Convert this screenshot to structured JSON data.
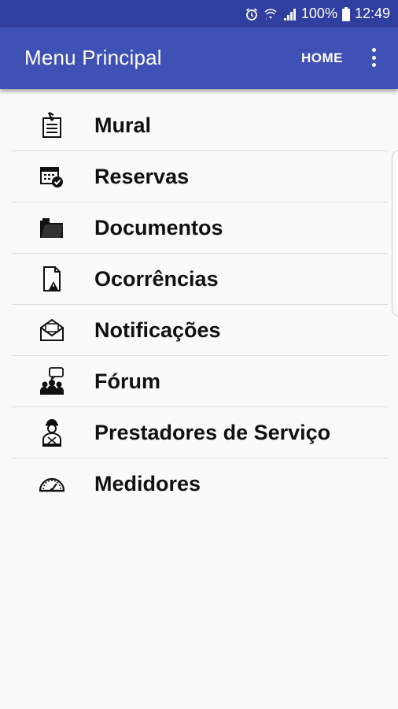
{
  "status_bar": {
    "battery": "100%",
    "time": "12:49",
    "icons": [
      "alarm-icon",
      "wifi-icon",
      "signal-icon",
      "battery-icon"
    ]
  },
  "app_bar": {
    "title": "Menu Principal",
    "home_label": "HOME",
    "overflow_icon": "more-vert-icon",
    "color": "#3f51b5",
    "status_color": "#303f9f"
  },
  "menu": {
    "items": [
      {
        "label": "Mural",
        "icon": "bulletin-board-icon"
      },
      {
        "label": "Reservas",
        "icon": "calendar-check-icon"
      },
      {
        "label": "Documentos",
        "icon": "folder-icon"
      },
      {
        "label": "Ocorrências",
        "icon": "document-warning-icon"
      },
      {
        "label": "Notificações",
        "icon": "envelope-icon"
      },
      {
        "label": "Fórum",
        "icon": "forum-people-icon"
      },
      {
        "label": "Prestadores de Serviço",
        "icon": "service-provider-icon"
      },
      {
        "label": "Medidores",
        "icon": "gauge-icon"
      }
    ]
  }
}
